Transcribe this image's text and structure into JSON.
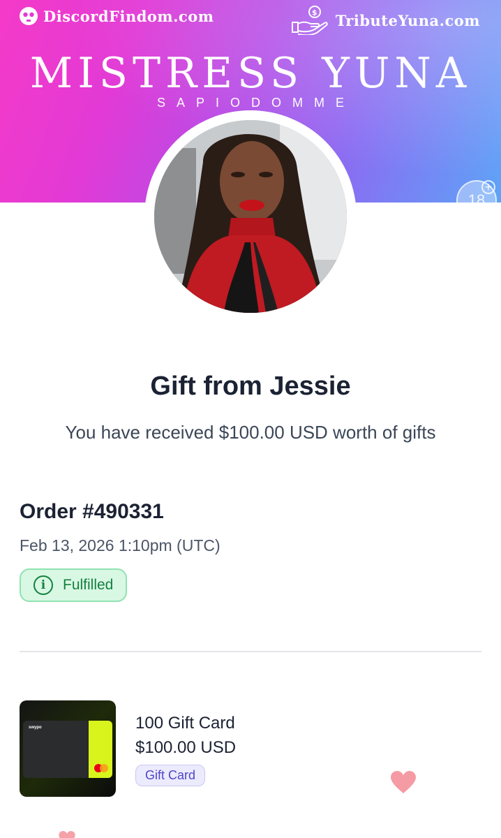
{
  "header": {
    "brand_left": "DiscordFindom.com",
    "brand_right": "TributeYuna.com",
    "hero_title": "MISTRESS YUNA",
    "hero_subtitle": "SAPIODOMME",
    "age_badge": "18",
    "age_badge_plus": "+"
  },
  "gift": {
    "title": "Gift from Jessie",
    "subtitle": "You have received $100.00 USD worth of gifts"
  },
  "order": {
    "title": "Order #490331",
    "date": "Feb 13, 2026 1:10pm (UTC)",
    "status": "Fulfilled",
    "status_icon": "i"
  },
  "item": {
    "name": "100 Gift Card",
    "price": "$100.00 USD",
    "tag": "Gift Card",
    "card_logo": "swypo"
  },
  "colors": {
    "banner_start": "#f53ac8",
    "banner_end": "#5ea4f7",
    "status_green": "#15803d",
    "tag_purple": "#4f46c8"
  }
}
